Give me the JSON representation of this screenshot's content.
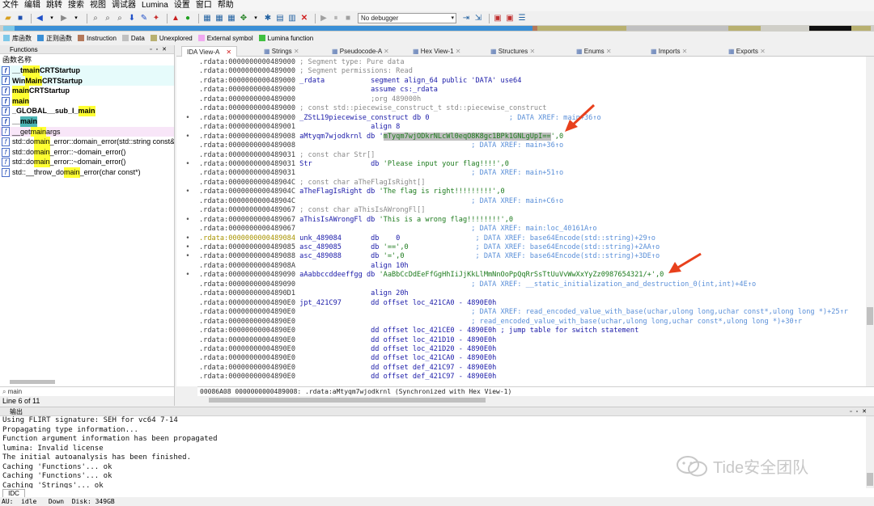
{
  "menu": [
    "文件",
    "编辑",
    "跳转",
    "搜索",
    "视图",
    "调试器",
    "Lumina",
    "设置",
    "窗口",
    "帮助"
  ],
  "toolbar": {
    "debugger_value": "No debugger"
  },
  "legend": [
    {
      "label": "库函数",
      "color": "#7ec8e8"
    },
    {
      "label": "正则函数",
      "color": "#3a8fd6"
    },
    {
      "label": "Instruction",
      "color": "#b4785a"
    },
    {
      "label": "Data",
      "color": "#c0c0c0"
    },
    {
      "label": "Unexplored",
      "color": "#b8b070"
    },
    {
      "label": "External symbol",
      "color": "#f0a8f0"
    },
    {
      "label": "Lumina function",
      "color": "#40c040"
    }
  ],
  "functions": {
    "title": "Functions",
    "column": "函数名称",
    "filter": "main",
    "status": "Line 6 of 11",
    "items": [
      {
        "pre": "__t",
        "hl": "main",
        "post": "CRTStartup",
        "bold": true,
        "bg": "cyan"
      },
      {
        "pre": "Win",
        "hl": "Main",
        "post": "CRTStartup",
        "bold": true,
        "bg": "cyan"
      },
      {
        "pre": "",
        "hl": "main",
        "post": "CRTStartup",
        "bold": true,
        "bg": ""
      },
      {
        "pre": "",
        "hl": "main",
        "post": "",
        "bold": true,
        "bg": ""
      },
      {
        "pre": "_GLOBAL__sub_I_",
        "hl": "main",
        "post": "",
        "bold": true,
        "bg": ""
      },
      {
        "pre": "__",
        "hl": "main",
        "post": "",
        "bold": true,
        "bg": "",
        "selected": true
      },
      {
        "pre": "__get",
        "hl": "main",
        "post": "args",
        "bold": false,
        "bg": "pink"
      },
      {
        "pre": "std::do",
        "hl": "main",
        "post": "_error::domain_error(std::string const&",
        "bold": false,
        "bg": ""
      },
      {
        "pre": "std::do",
        "hl": "main",
        "post": "_error::~domain_error()",
        "bold": false,
        "bg": ""
      },
      {
        "pre": "std::do",
        "hl": "main",
        "post": "_error::~domain_error()",
        "bold": false,
        "bg": ""
      },
      {
        "pre": "std::__throw_do",
        "hl": "main",
        "post": "_error(char const*)",
        "bold": false,
        "bg": ""
      }
    ]
  },
  "tabs": [
    "IDA View-A",
    "Strings",
    "Pseudocode-A",
    "Hex View-1",
    "Structures",
    "Enums",
    "Imports",
    "Exports"
  ],
  "ida_lines": [
    {
      "g": "",
      "a": ".rdata:0000000000489000",
      "s": [
        {
          "t": " ; Segment type: Pure data",
          "c": "cmt"
        }
      ]
    },
    {
      "g": "",
      "a": ".rdata:0000000000489000",
      "s": [
        {
          "t": " ; Segment permissions: Read",
          "c": "cmt"
        }
      ]
    },
    {
      "g": "",
      "a": ".rdata:0000000000489000",
      "s": [
        {
          "t": " _rdata           segment align_64 public 'DATA' use64",
          "c": "kw"
        }
      ]
    },
    {
      "g": "",
      "a": ".rdata:0000000000489000",
      "s": [
        {
          "t": "                  assume cs:_rdata",
          "c": "kw"
        }
      ]
    },
    {
      "g": "",
      "a": ".rdata:0000000000489000",
      "s": [
        {
          "t": "                  ;org 489000h",
          "c": "cmt"
        }
      ]
    },
    {
      "g": "",
      "a": ".rdata:0000000000489000",
      "s": [
        {
          "t": " ; const std::piecewise_construct_t std::piecewise_construct",
          "c": "cmt"
        }
      ]
    },
    {
      "g": "•",
      "a": ".rdata:0000000000489000",
      "s": [
        {
          "t": " _ZStL19piecewise_construct db 0",
          "c": "lbl"
        },
        {
          "t": "                   ; DATA XREF: main+36↑o",
          "c": "xref"
        }
      ]
    },
    {
      "g": "",
      "a": ".rdata:0000000000489001",
      "s": [
        {
          "t": "                  align 8",
          "c": "kw"
        }
      ]
    },
    {
      "g": "•",
      "a": ".rdata:0000000000489008",
      "s": [
        {
          "t": " aMtyqm7wjodkrnl db '",
          "c": "lbl"
        },
        {
          "t": "mTyqm7wjODkrNLcWl0eqO8K8gc1BPk1GNLgUpI==",
          "c": "hlstr"
        },
        {
          "t": "',0",
          "c": "str"
        }
      ]
    },
    {
      "g": "",
      "a": ".rdata:0000000000489008",
      "s": [
        {
          "t": "                                          ; DATA XREF: main+36↑o",
          "c": "xref"
        }
      ]
    },
    {
      "g": "",
      "a": ".rdata:0000000000489031",
      "s": [
        {
          "t": " ; const char Str[]",
          "c": "cmt"
        }
      ]
    },
    {
      "g": "•",
      "a": ".rdata:0000000000489031",
      "s": [
        {
          "t": " Str              db ",
          "c": "lbl"
        },
        {
          "t": "'Please input your flag!!!!',0",
          "c": "str"
        }
      ]
    },
    {
      "g": "",
      "a": ".rdata:0000000000489031",
      "s": [
        {
          "t": "                                          ; DATA XREF: main+51↑o",
          "c": "xref"
        }
      ]
    },
    {
      "g": "",
      "a": ".rdata:000000000048904C",
      "s": [
        {
          "t": " ; const char aTheFlagIsRight[]",
          "c": "cmt"
        }
      ]
    },
    {
      "g": "•",
      "a": ".rdata:000000000048904C",
      "s": [
        {
          "t": " aTheFlagIsRight db ",
          "c": "lbl"
        },
        {
          "t": "'The flag is right!!!!!!!!!',0",
          "c": "str"
        }
      ]
    },
    {
      "g": "",
      "a": ".rdata:000000000048904C",
      "s": [
        {
          "t": "                                          ; DATA XREF: main+C6↑o",
          "c": "xref"
        }
      ]
    },
    {
      "g": "",
      "a": ".rdata:0000000000489067",
      "s": [
        {
          "t": " ; const char aThisIsAWrongFl[]",
          "c": "cmt"
        }
      ]
    },
    {
      "g": "•",
      "a": ".rdata:0000000000489067",
      "s": [
        {
          "t": " aThisIsAWrongFl db ",
          "c": "lbl"
        },
        {
          "t": "'This is a wrong flag!!!!!!!!',0",
          "c": "str"
        }
      ]
    },
    {
      "g": "",
      "a": ".rdata:0000000000489067",
      "s": [
        {
          "t": "                                          ; DATA XREF: main:loc_40161A↑o",
          "c": "xref"
        }
      ]
    },
    {
      "g": "•",
      "a": ".rdata:0000000000489084",
      "y": true,
      "s": [
        {
          "t": " unk_489084       db    0",
          "c": "lbl"
        },
        {
          "t": "                  ; DATA XREF: base64Encode(std::string)+29↑o",
          "c": "xref"
        }
      ]
    },
    {
      "g": "•",
      "a": ".rdata:0000000000489085",
      "s": [
        {
          "t": " asc_489085       db ",
          "c": "lbl"
        },
        {
          "t": "'==',0",
          "c": "str"
        },
        {
          "t": "                ; DATA XREF: base64Encode(std::string)+2AA↑o",
          "c": "xref"
        }
      ]
    },
    {
      "g": "•",
      "a": ".rdata:0000000000489088",
      "s": [
        {
          "t": " asc_489088       db ",
          "c": "lbl"
        },
        {
          "t": "'=',0",
          "c": "str"
        },
        {
          "t": "                 ; DATA XREF: base64Encode(std::string)+3DE↑o",
          "c": "xref"
        }
      ]
    },
    {
      "g": "",
      "a": ".rdata:000000000048908A",
      "s": [
        {
          "t": "                  align 10h",
          "c": "kw"
        }
      ]
    },
    {
      "g": "•",
      "a": ".rdata:0000000000489090",
      "s": [
        {
          "t": " aAabbccddeeffgg db ",
          "c": "lbl"
        },
        {
          "t": "'AaBbCcDdEeFfGgHhIiJjKkLlMmNnOoPpQqRrSsTtUuVvWwXxYyZz0987654321/+',0",
          "c": "str"
        }
      ]
    },
    {
      "g": "",
      "a": ".rdata:0000000000489090",
      "s": [
        {
          "t": "                                          ; DATA XREF: __static_initialization_and_destruction_0(int,int)+4E↑o",
          "c": "xref"
        }
      ]
    },
    {
      "g": "",
      "a": ".rdata:00000000004890D1",
      "s": [
        {
          "t": "                  align 20h",
          "c": "kw"
        }
      ]
    },
    {
      "g": "",
      "a": ".rdata:00000000004890E0",
      "s": [
        {
          "t": " jpt_421C97       dd offset loc_421CA0 - 4890E0h",
          "c": "lbl"
        }
      ]
    },
    {
      "g": "",
      "a": ".rdata:00000000004890E0",
      "s": [
        {
          "t": "                                          ; DATA XREF: read_encoded_value_with_base(uchar,ulong long,uchar const*,ulong long *)+25↑r",
          "c": "xref"
        }
      ]
    },
    {
      "g": "",
      "a": ".rdata:00000000004890E0",
      "s": [
        {
          "t": "                                          ; read_encoded_value_with_base(uchar,ulong long,uchar const*,ulong long *)+30↑r",
          "c": "xref"
        }
      ]
    },
    {
      "g": "",
      "a": ".rdata:00000000004890E0",
      "s": [
        {
          "t": "                  dd offset loc_421CE0 - 4890E0h ; jump table for switch statement",
          "c": "kw"
        }
      ]
    },
    {
      "g": "",
      "a": ".rdata:00000000004890E0",
      "s": [
        {
          "t": "                  dd offset loc_421D10 - 4890E0h",
          "c": "kw"
        }
      ]
    },
    {
      "g": "",
      "a": ".rdata:00000000004890E0",
      "s": [
        {
          "t": "                  dd offset loc_421D20 - 4890E0h",
          "c": "kw"
        }
      ]
    },
    {
      "g": "",
      "a": ".rdata:00000000004890E0",
      "s": [
        {
          "t": "                  dd offset loc_421CA0 - 4890E0h",
          "c": "kw"
        }
      ]
    },
    {
      "g": "",
      "a": ".rdata:00000000004890E0",
      "s": [
        {
          "t": "                  dd offset def_421C97 - 4890E0h",
          "c": "kw"
        }
      ]
    },
    {
      "g": "",
      "a": ".rdata:00000000004890E0",
      "s": [
        {
          "t": "                  dd offset def_421C97 - 4890E0h",
          "c": "kw"
        }
      ]
    }
  ],
  "ida_status": "00086A08 0000000000489008: .rdata:aMtyqm7wjodkrnl (Synchronized with Hex View-1)",
  "output": {
    "title": "输出",
    "lines": [
      "Using FLIRT signature: SEH for vc64 7-14",
      "Propagating type information...",
      "Function argument information has been propagated",
      "lumina: Invalid license",
      "The initial autoanalysis has been finished.",
      "Caching 'Functions'... ok",
      "Caching 'Functions'... ok",
      "Caching 'Strings'... ok"
    ],
    "idc_label": "IDC"
  },
  "statusbar": {
    "au": "AU:  idle",
    "dir": "Down",
    "disk": "Disk: 349GB"
  },
  "watermark": "Tide安全团队",
  "colors": {
    "highlight": "#ffff33",
    "selected": "#4bb4b4",
    "arrow": "#e8401c"
  }
}
